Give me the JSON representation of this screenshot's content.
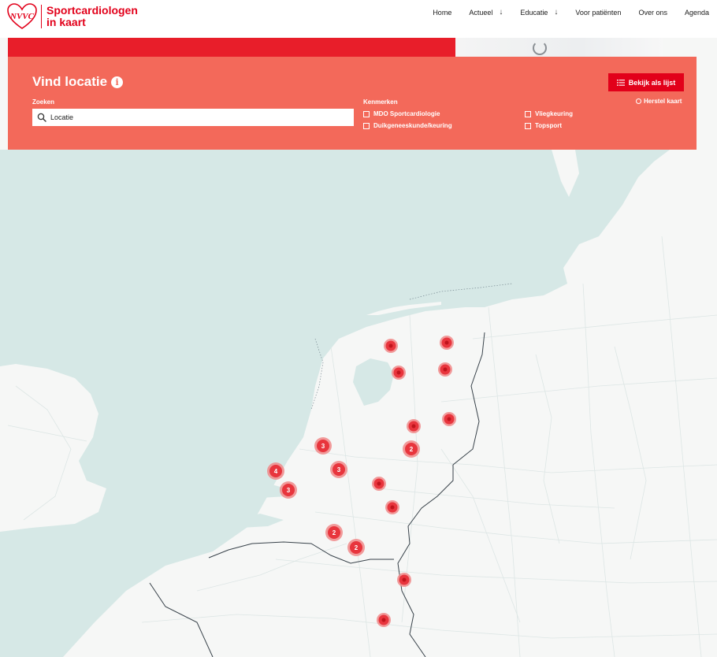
{
  "site": {
    "logo_mark": "NVVC",
    "name_line1": "Sportcardiologen",
    "name_line2": "in kaart"
  },
  "nav": {
    "items": [
      {
        "label": "Home"
      },
      {
        "label": "Actueel",
        "has_dropdown": true
      },
      {
        "label": "Educatie",
        "has_dropdown": true
      },
      {
        "label": "Voor patiënten"
      },
      {
        "label": "Over ons"
      },
      {
        "label": "Agenda"
      }
    ],
    "dropdown_icon": "arrow-down-icon"
  },
  "finder": {
    "title": "Vind locatie",
    "info_icon": "i",
    "search_label": "Zoeken",
    "search_placeholder": "Locatie",
    "features_label": "Kenmerken",
    "features": [
      {
        "label": "MDO Sportcardiologie",
        "checked": false
      },
      {
        "label": "Duikgeneeskunde/keuring",
        "checked": false
      },
      {
        "label": "Vliegkeuring",
        "checked": false
      },
      {
        "label": "Topsport",
        "checked": false
      }
    ],
    "list_button": "Bekijk als lijst",
    "reset_link": "Herstel kaart"
  },
  "colors": {
    "brand_red": "#e2001a",
    "panel_coral": "#f3695a",
    "sea": "#d6e8e6",
    "land": "#f6f7f6",
    "marker": "#e8353d"
  },
  "map": {
    "markers": [
      {
        "count": ""
      },
      {
        "count": ""
      },
      {
        "count": ""
      },
      {
        "count": ""
      },
      {
        "count": ""
      },
      {
        "count": ""
      },
      {
        "count": "2"
      },
      {
        "count": "3"
      },
      {
        "count": "3"
      },
      {
        "count": "4"
      },
      {
        "count": "3"
      },
      {
        "count": ""
      },
      {
        "count": ""
      },
      {
        "count": "2"
      },
      {
        "count": "2"
      },
      {
        "count": ""
      },
      {
        "count": ""
      }
    ]
  }
}
